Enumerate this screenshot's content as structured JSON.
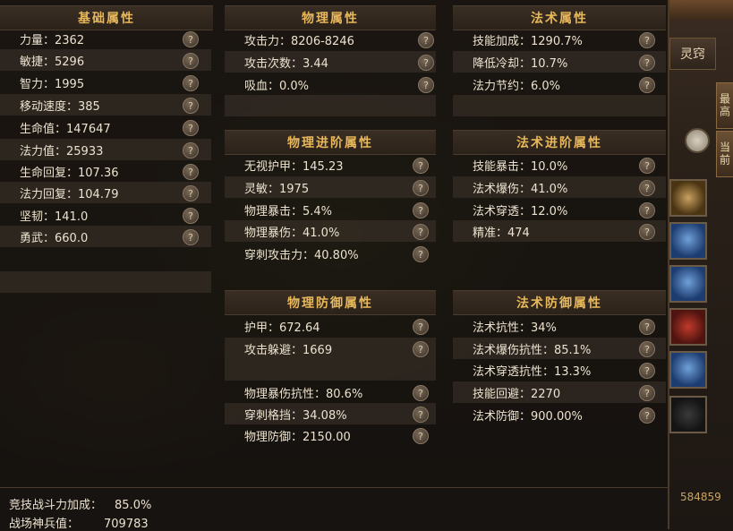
{
  "sections": {
    "basic": {
      "title": "基础属性",
      "rows": [
        {
          "label": "力量：2362"
        },
        {
          "label": "敏捷：5296"
        },
        {
          "label": "智力：1995"
        },
        {
          "label": "移动速度：385"
        },
        {
          "label": "生命值：147647"
        },
        {
          "label": "法力值：25933"
        },
        {
          "label": "生命回复：107.36"
        },
        {
          "label": "法力回复：104.79"
        },
        {
          "label": "坚韧：141.0"
        },
        {
          "label": "勇武：660.0"
        }
      ]
    },
    "physical": {
      "title": "物理属性",
      "rows": [
        {
          "label": "攻击力：8206-8246"
        },
        {
          "label": "攻击次数：3.44"
        },
        {
          "label": "吸血：0.0%"
        }
      ]
    },
    "magic": {
      "title": "法术属性",
      "rows": [
        {
          "label": "技能加成：1290.7%"
        },
        {
          "label": "降低冷却：10.7%"
        },
        {
          "label": "法力节约：6.0%"
        }
      ]
    },
    "physical_adv": {
      "title": "物理进阶属性",
      "rows": [
        {
          "label": "无视护甲：145.23"
        },
        {
          "label": "灵敏：1975"
        },
        {
          "label": "物理暴击：5.4%"
        },
        {
          "label": "物理暴伤：41.0%"
        },
        {
          "label": "穿刺攻击力：40.80%"
        }
      ]
    },
    "magic_adv": {
      "title": "法术进阶属性",
      "rows": [
        {
          "label": "技能暴击：10.0%"
        },
        {
          "label": "法术爆伤：41.0%"
        },
        {
          "label": "法术穿透：12.0%"
        },
        {
          "label": "精准：474"
        }
      ]
    },
    "physical_def": {
      "title": "物理防御属性",
      "rows": [
        {
          "label": "护甲：672.64"
        },
        {
          "label": "攻击躲避：1669"
        },
        {
          "label": "物理暴伤抗性：80.6%"
        },
        {
          "label": "穿刺格挡：34.08%"
        },
        {
          "label": "物理防御：2150.00"
        }
      ]
    },
    "magic_def": {
      "title": "法术防御属性",
      "rows": [
        {
          "label": "法术抗性：34%"
        },
        {
          "label": "法术爆伤抗性：85.1%"
        },
        {
          "label": "法术穿透抗性：13.3%"
        },
        {
          "label": "技能回避：2270"
        },
        {
          "label": "法术防御：900.00%"
        }
      ]
    }
  },
  "help_glyph": "?",
  "footer": {
    "arena_label": "竞技战斗力加成：",
    "arena_value": "85.0%",
    "battlefield_label": "战场神兵值：",
    "battlefield_value": "709783"
  },
  "side": {
    "tab_label": "灵窍",
    "btn_top": "最高",
    "btn_current": "当前",
    "bg_value": "584859"
  }
}
